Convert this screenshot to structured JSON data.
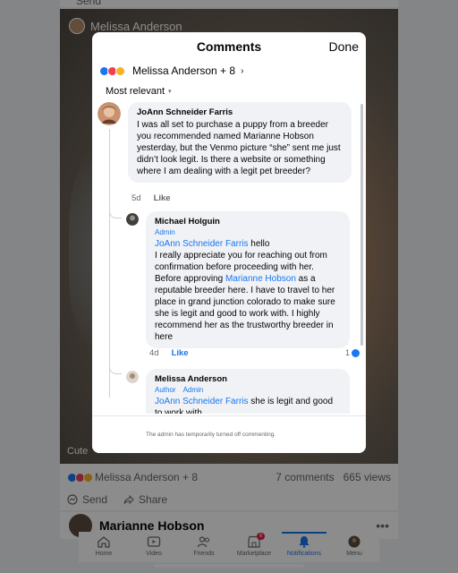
{
  "background": {
    "top_action": "Send",
    "post_author": "Melissa Anderson",
    "post_caption": "Cute",
    "reactions_text": "Melissa Anderson + 8",
    "comments_count": "7 comments",
    "views_count": "665 views",
    "send_label": "Send",
    "share_label": "Share",
    "next_post_author": "Marianne Hobson",
    "more_dots": "•••"
  },
  "tabbar": {
    "tabs": [
      {
        "label": "Home",
        "icon": "home-icon"
      },
      {
        "label": "Video",
        "icon": "video-icon"
      },
      {
        "label": "Friends",
        "icon": "friends-icon"
      },
      {
        "label": "Marketplace",
        "icon": "marketplace-icon",
        "badge": "6"
      },
      {
        "label": "Notifications",
        "icon": "bell-icon",
        "active": true
      },
      {
        "label": "Menu",
        "icon": "menu-avatar"
      }
    ]
  },
  "modal": {
    "title": "Comments",
    "done_label": "Done",
    "reactors_text": "Melissa Anderson + 8",
    "reactors_chevron": "›",
    "sort_label": "Most relevant",
    "sort_chevron": "▾",
    "footer_text": "The admin has temporarily turned off commenting."
  },
  "comments": [
    {
      "author": "JoAnn Schneider Farris",
      "text": "I was all set to purchase a puppy from a breeder you recommended named Marianne Hobson yesterday, but the Venmo picture “she” sent me just didn’t look legit.  Is there a website or something where I am dealing with a legit pet breeder?",
      "time": "5d",
      "like_label": "Like"
    },
    {
      "author": "Michael Holguin",
      "role": "Admin",
      "mention": "JoAnn Schneider Farris",
      "text_after_mention": " hello\nI really appreciate you for reaching out from confirmation before proceeding with her. Before approving ",
      "mention2": "Marianne Hobson",
      "text_end": " as a reputable breeder here. I have to travel to her place in grand junction colorado to make sure she is legit and good to work with. I highly recommend her as the trustworthy breeder in here",
      "time": "4d",
      "like_label": "Like",
      "reaction_count": "1"
    },
    {
      "author": "Melissa Anderson",
      "role1": "Author",
      "role2": "Admin",
      "mention": "JoAnn Schneider Farris",
      "text_after_mention": " she is legit and good to work with."
    }
  ]
}
